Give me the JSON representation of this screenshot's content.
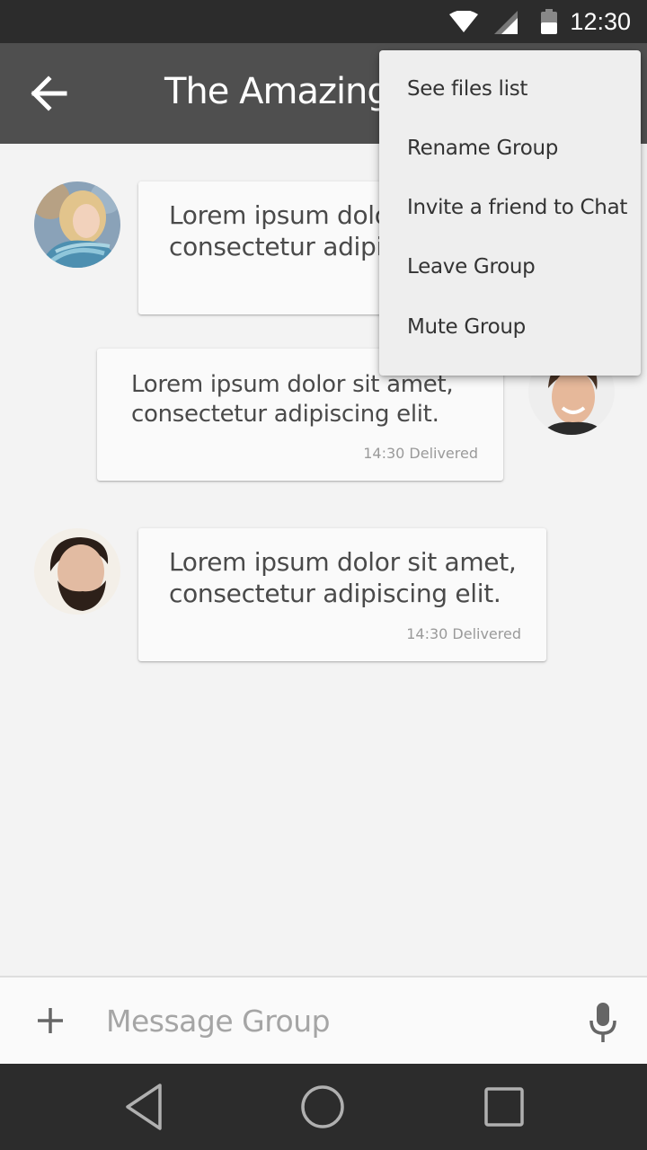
{
  "status_bar": {
    "time": "12:30",
    "icons": [
      "wifi-icon",
      "cell-signal-icon",
      "battery-icon"
    ]
  },
  "app_bar": {
    "title": "The Amazing",
    "back_icon": "arrow-back-icon"
  },
  "messages": [
    {
      "sender": "incoming",
      "text_line1": "Lorem ipsum dolo",
      "text_line2": "consectetur adipis",
      "meta": ""
    },
    {
      "sender": "outgoing",
      "text_line1": "Lorem ipsum dolor sit amet,",
      "text_line2": "consectetur adipiscing elit.",
      "meta": "14:30 Delivered"
    },
    {
      "sender": "incoming",
      "text_line1": "Lorem ipsum dolor sit amet,",
      "text_line2": "consectetur adipiscing elit.",
      "meta": "14:30 Delivered"
    }
  ],
  "menu": {
    "items": [
      "See files list",
      "Rename Group",
      "Invite a friend to Chat",
      "Leave Group",
      "Mute Group"
    ]
  },
  "compose": {
    "placeholder": "Message Group",
    "add_icon": "plus-icon",
    "mic_icon": "microphone-icon"
  },
  "nav_bar": {
    "icons": [
      "back-triangle-icon",
      "home-circle-icon",
      "recents-square-icon"
    ]
  },
  "colors": {
    "status_bar": "#2c2c2c",
    "app_bar": "#4f4f4f",
    "background": "#f3f3f3",
    "bubble": "#fafafa",
    "menu": "#eeeeee"
  }
}
